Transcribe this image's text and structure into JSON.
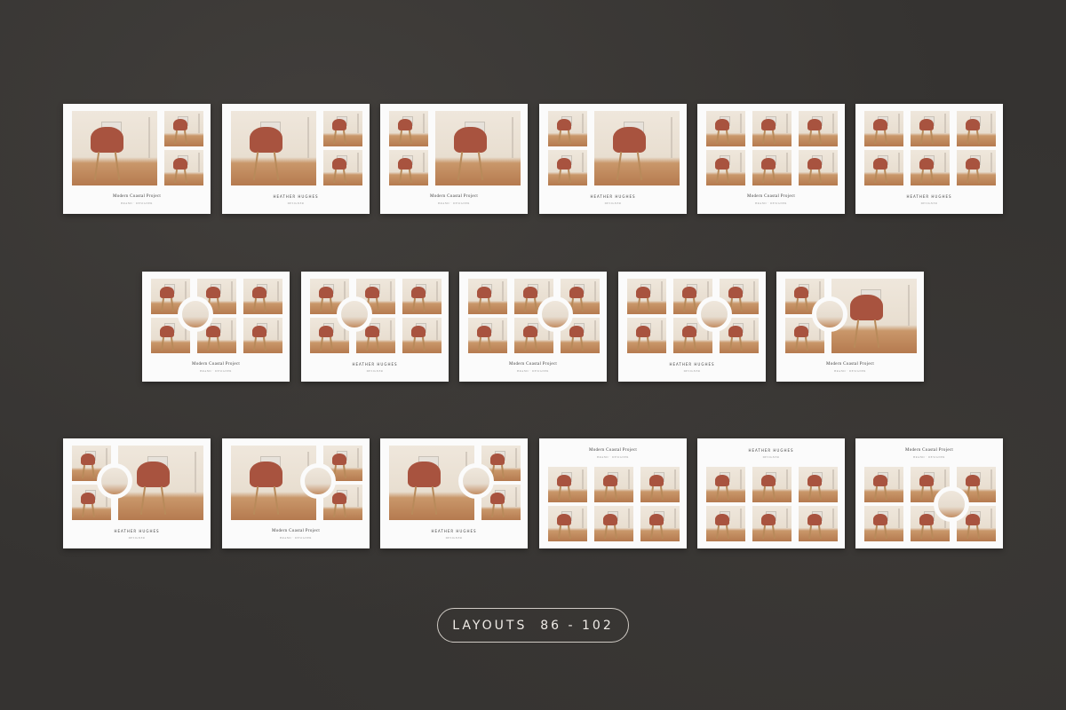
{
  "footer": {
    "label": "LAYOUTS  86 - 102"
  },
  "captions": {
    "project": "Modern Coastal Project",
    "name": "HEATHER HUGHES",
    "sub_a": "BRAND · DESIGNER",
    "sub_b": "DESIGNER"
  },
  "colors": {
    "background": "#353331",
    "card": "#fbfbfb",
    "chair": "#a8533f",
    "floor": "#b57a4f",
    "wall": "#efe7dc"
  },
  "icons": {
    "pill": "rounded-outline-badge"
  }
}
